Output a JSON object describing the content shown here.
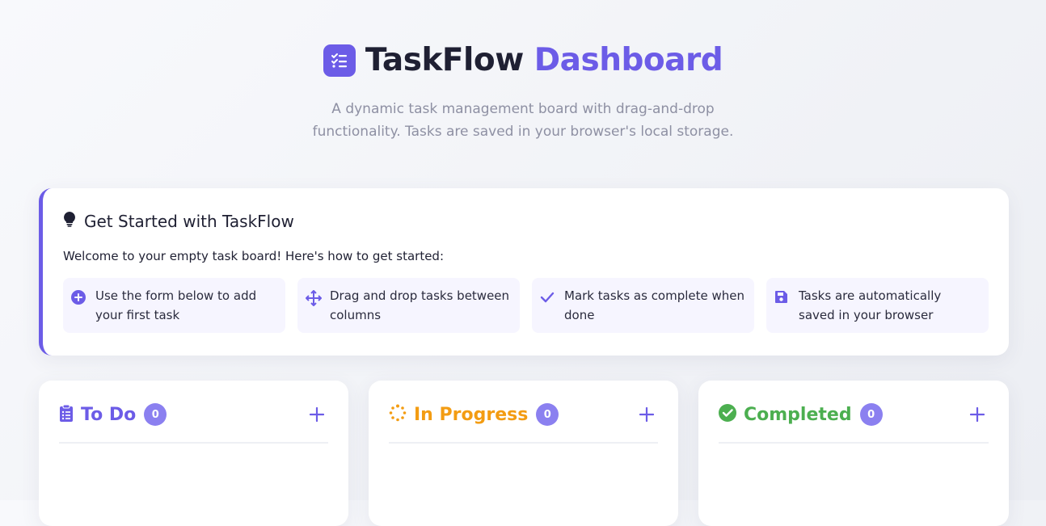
{
  "header": {
    "title_part1": "TaskFlow",
    "title_part2": "Dashboard",
    "subtitle": "A dynamic task management board with drag-and-drop functionality. Tasks are saved in your browser's local storage.",
    "logo_icon": "tasks-checklist-icon"
  },
  "intro": {
    "title": "Get Started with TaskFlow",
    "title_icon": "lightbulb-icon",
    "text": "Welcome to your empty task board! Here's how to get started:",
    "tips": [
      {
        "icon": "plus-circle-icon",
        "text": "Use the form below to add your first task"
      },
      {
        "icon": "move-arrows-icon",
        "text": "Drag and drop tasks between columns"
      },
      {
        "icon": "check-icon",
        "text": "Mark tasks as complete when done"
      },
      {
        "icon": "save-icon",
        "text": "Tasks are automatically saved in your browser"
      }
    ]
  },
  "columns": [
    {
      "title": "To Do",
      "count": "0",
      "color": "#6c5ce7",
      "icon": "clipboard-list-icon"
    },
    {
      "title": "In Progress",
      "count": "0",
      "color": "#f39c12",
      "icon": "spinner-icon"
    },
    {
      "title": "Completed",
      "count": "0",
      "color": "#4caf50",
      "icon": "check-circle-icon"
    }
  ],
  "colors": {
    "accent": "#6c5ce7",
    "badge": "#8b80f0",
    "tip_bg": "#f6f5ff"
  }
}
